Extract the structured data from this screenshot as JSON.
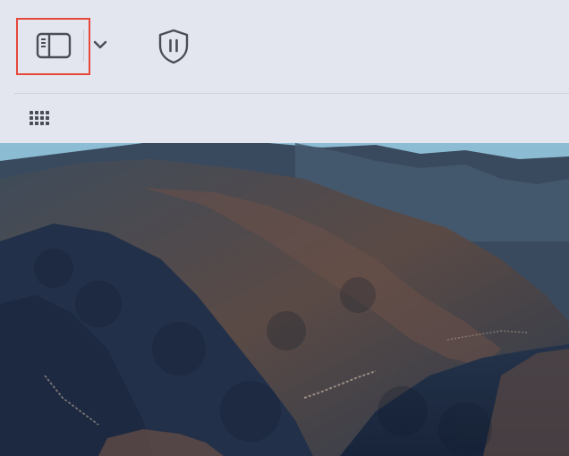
{
  "toolbar": {
    "sidebar_button": {
      "icon": "sidebar-icon",
      "highlighted": true
    },
    "tab_group_chevron": {
      "icon": "chevron-down-icon"
    },
    "privacy_button": {
      "icon": "shield-pause-icon"
    },
    "start_page_button": {
      "icon": "grid-icon"
    }
  },
  "background": {
    "type": "photo",
    "subject": "mountain",
    "colors": {
      "sky": "#7fb3cc",
      "ridge_dark": "#1f2e40",
      "ridge_mid": "#34465a",
      "slope_brown": "#5b4a44"
    }
  },
  "colors": {
    "toolbar_bg": "#e4e6ef",
    "icon_color": "#4a4d57",
    "highlight_border": "#e5483a"
  }
}
